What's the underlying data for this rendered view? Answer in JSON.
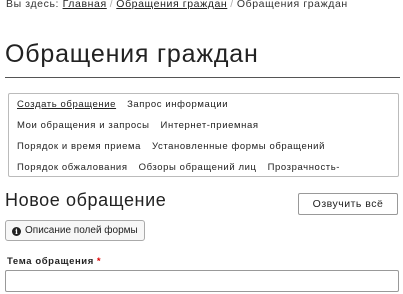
{
  "breadcrumb": {
    "prefix": "Вы здесь:",
    "home": "Главная",
    "parent": "Обращения граждан",
    "current": "Обращения граждан"
  },
  "page_title": "Обращения граждан",
  "nav": {
    "rows": [
      [
        "Создать обращение",
        "Запрос информации"
      ],
      [
        "Мои обращения и запросы",
        "Интернет-приемная"
      ],
      [
        "Порядок и время приема",
        "Установленные формы обращений"
      ],
      [
        "Порядок обжалования",
        "Обзоры обращений лиц",
        "Прозрачность-"
      ]
    ],
    "active": "Создать обращение"
  },
  "section_title": "Новое обращение",
  "speak_button": "Озвучить всё",
  "fields_button": "Описание полей формы",
  "form": {
    "topic_label": "Тема обращения",
    "required_mark": "*",
    "topic_value": ""
  }
}
